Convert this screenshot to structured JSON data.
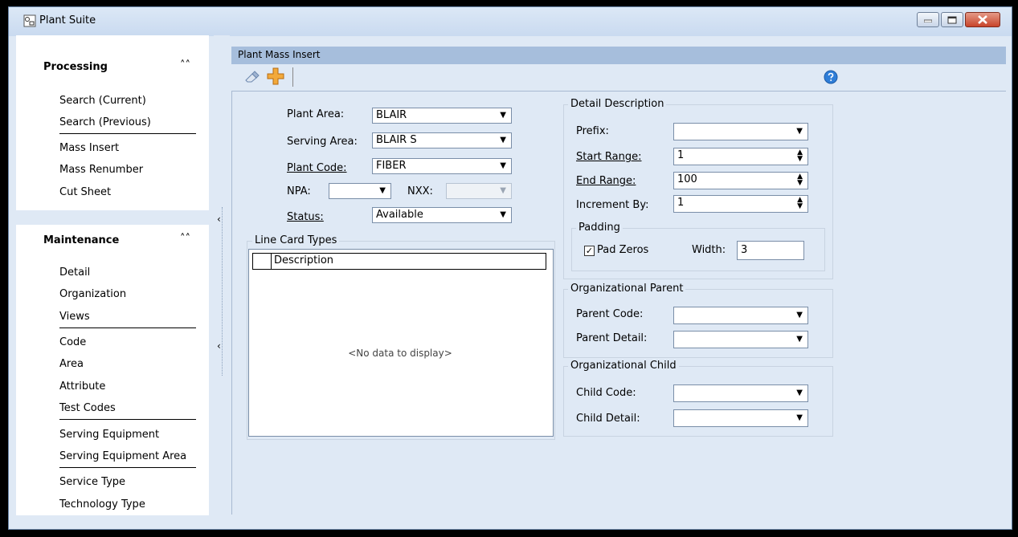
{
  "window": {
    "title": "Plant Suite"
  },
  "sidebar": {
    "processing": {
      "title": "Processing",
      "items": [
        "Search (Current)",
        "Search (Previous)",
        "Mass Insert",
        "Mass Renumber",
        "Cut Sheet"
      ]
    },
    "maintenance": {
      "title": "Maintenance",
      "items": [
        "Detail",
        "Organization",
        "Views",
        "Code",
        "Area",
        "Attribute",
        "Test Codes",
        "Serving Equipment",
        "Serving Equipment Area",
        "Service Type",
        "Technology Type"
      ]
    }
  },
  "main": {
    "title": "Plant Mass Insert",
    "form": {
      "plant_area": {
        "label": "Plant Area:",
        "value": "BLAIR"
      },
      "serving_area": {
        "label": "Serving Area:",
        "value": "BLAIR S"
      },
      "plant_code": {
        "label": "Plant Code:",
        "value": "FIBER"
      },
      "npa": {
        "label": "NPA:",
        "value": ""
      },
      "nxx": {
        "label": "NXX:",
        "value": ""
      },
      "status": {
        "label": "Status:",
        "value": "Available"
      }
    },
    "line_card_types": {
      "title": "Line Card Types",
      "column": "Description",
      "empty_text": "<No data to display>"
    },
    "detail_description": {
      "title": "Detail Description",
      "prefix": {
        "label": "Prefix:",
        "value": ""
      },
      "start_range": {
        "label": "Start Range:",
        "value": "1"
      },
      "end_range": {
        "label": "End Range:",
        "value": "100"
      },
      "increment_by": {
        "label": "Increment By:",
        "value": "1"
      },
      "padding": {
        "title": "Padding",
        "pad_zeros_label": "Pad Zeros",
        "pad_zeros_checked": true,
        "width_label": "Width:",
        "width_value": "3"
      }
    },
    "org_parent": {
      "title": "Organizational Parent",
      "parent_code": {
        "label": "Parent Code:",
        "value": ""
      },
      "parent_detail": {
        "label": "Parent Detail:",
        "value": ""
      }
    },
    "org_child": {
      "title": "Organizational Child",
      "child_code": {
        "label": "Child Code:",
        "value": ""
      },
      "child_detail": {
        "label": "Child Detail:",
        "value": ""
      }
    }
  },
  "icons": {
    "app": "plant-suite-app-icon",
    "eraser": "eraser-icon",
    "add": "add-plus-icon",
    "help": "help-icon",
    "collapse": "double-chevron-up-icon",
    "splitter": "chevron-left-icon",
    "dropdown": "dropdown-arrow-icon",
    "spinner": "spinner-arrows-icon"
  },
  "colors": {
    "header_band": "#a6bedc",
    "panel_bg": "#dfe9f5",
    "close_button": "#c8442b"
  }
}
